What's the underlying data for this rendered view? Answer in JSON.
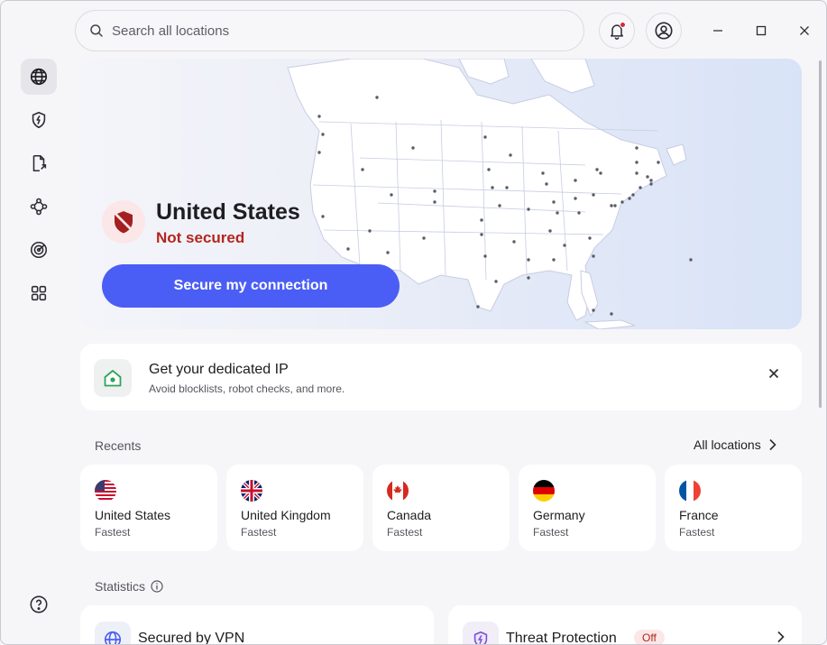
{
  "search": {
    "placeholder": "Search all locations"
  },
  "hero": {
    "country": "United States",
    "status": "Not secured",
    "cta": "Secure my connection"
  },
  "promo": {
    "title": "Get your dedicated IP",
    "subtitle": "Avoid blocklists, robot checks, and more."
  },
  "recents": {
    "label": "Recents",
    "all_label": "All locations",
    "items": [
      {
        "name": "United States",
        "sub": "Fastest",
        "flag": "us-flag"
      },
      {
        "name": "United Kingdom",
        "sub": "Fastest",
        "flag": "uk-flag"
      },
      {
        "name": "Canada",
        "sub": "Fastest",
        "flag": "ca-flag"
      },
      {
        "name": "Germany",
        "sub": "Fastest",
        "flag": "de-flag"
      },
      {
        "name": "France",
        "sub": "Fastest",
        "flag": "fr-flag"
      }
    ]
  },
  "statistics": {
    "label": "Statistics",
    "cards": [
      {
        "title": "Secured by VPN",
        "icon": "globe-icon"
      },
      {
        "title": "Threat Protection",
        "badge": "Off",
        "icon": "threat-shield-icon"
      }
    ]
  },
  "colors": {
    "accent": "#4a5ef5",
    "danger": "#b3261e",
    "notification": "#d7263d"
  }
}
